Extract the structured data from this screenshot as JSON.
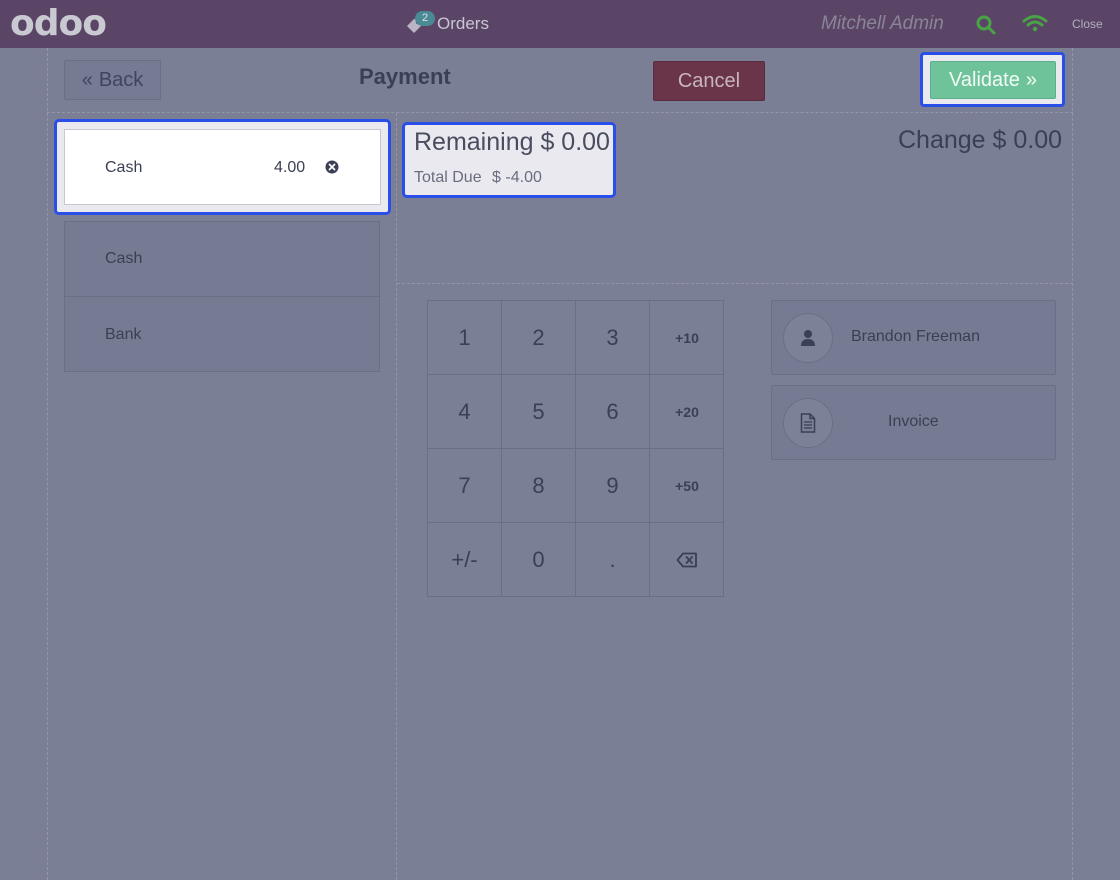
{
  "topbar": {
    "logo": "odoo",
    "orders_label": "Orders",
    "orders_count": "2",
    "user": "Mitchell Admin",
    "close_label": "Close"
  },
  "header": {
    "back_label": "Back",
    "title": "Payment",
    "cancel_label": "Cancel",
    "validate_label": "Validate"
  },
  "payment_line": {
    "name": "Cash",
    "amount": "4.00"
  },
  "payment_methods": [
    {
      "label": "Cash"
    },
    {
      "label": "Bank"
    }
  ],
  "status": {
    "remaining": "Remaining $ 0.00",
    "total_due_label": "Total Due",
    "total_due_value": "$ -4.00",
    "change": "Change $ 0.00"
  },
  "numpad": {
    "keys": [
      "1",
      "2",
      "3",
      "+10",
      "4",
      "5",
      "6",
      "+20",
      "7",
      "8",
      "9",
      "+50",
      "+/-",
      "0",
      "."
    ]
  },
  "customer": {
    "name": "Brandon Freeman",
    "invoice_label": "Invoice"
  },
  "colors": {
    "topbar": "#5b4566",
    "background": "#7b7f96",
    "validate": "#6fc39a",
    "cancel": "#6a3548",
    "highlight": "#2a4ee8"
  }
}
